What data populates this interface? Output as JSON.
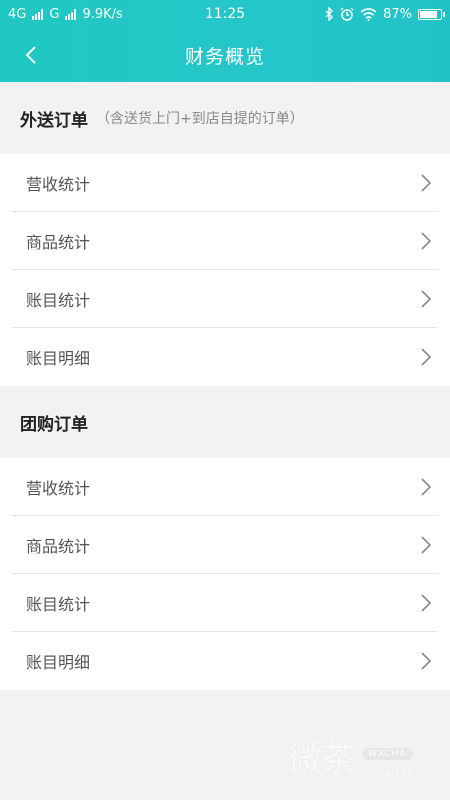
{
  "status_bar": {
    "network1": "4G",
    "network2": "G",
    "speed": "9.9K/s",
    "time": "11:25",
    "battery": "87%",
    "battery_level": 0.87
  },
  "header": {
    "title": "财务概览",
    "back_icon": "chevron-left-icon"
  },
  "sections": [
    {
      "title": "外送订单",
      "note": "（含送货上门+到店自提的订单）",
      "items": [
        {
          "label": "营收统计"
        },
        {
          "label": "商品统计"
        },
        {
          "label": "账目统计"
        },
        {
          "label": "账目明细"
        }
      ]
    },
    {
      "title": "团购订单",
      "note": "",
      "items": [
        {
          "label": "营收统计"
        },
        {
          "label": "商品统计"
        },
        {
          "label": "账目统计"
        },
        {
          "label": "账目明细"
        }
      ]
    }
  ],
  "watermark": {
    "text": "微茶",
    "badge": "WXCHA",
    "domain": ".com"
  },
  "colors": {
    "header": "#22c6c6",
    "background": "#f2f2f2",
    "divider": "#e3e3e3"
  }
}
